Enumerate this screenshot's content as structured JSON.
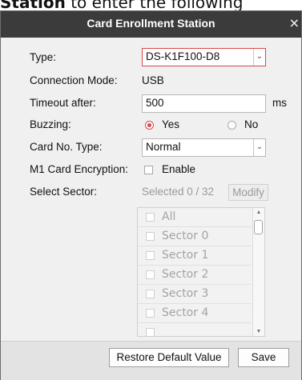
{
  "background": {
    "caption_bold": "Station",
    "caption_rest": " to enter the following"
  },
  "dialog": {
    "title": "Card Enrollment Station",
    "close_glyph": "×",
    "type": {
      "label": "Type:",
      "value": "DS-K1F100-D8"
    },
    "connection_mode": {
      "label": "Connection Mode:",
      "value": "USB"
    },
    "timeout": {
      "label": "Timeout after:",
      "value": "500",
      "unit": "ms"
    },
    "buzzing": {
      "label": "Buzzing:",
      "yes": "Yes",
      "no": "No",
      "selected": "Yes"
    },
    "card_no_type": {
      "label": "Card No. Type:",
      "value": "Normal"
    },
    "m1_encryption": {
      "label": "M1 Card Encryption:",
      "option": "Enable",
      "checked": false
    },
    "select_sector": {
      "label": "Select Sector:",
      "summary": "Selected 0 / 32",
      "modify": "Modify",
      "items": [
        "All",
        "Sector 0",
        "Sector 1",
        "Sector 2",
        "Sector 3",
        "Sector 4"
      ]
    },
    "footer": {
      "restore": "Restore Default Value",
      "save": "Save"
    }
  },
  "colors": {
    "titlebar": "#3b3b3b",
    "accent": "#d84848",
    "dialog_bg": "#f0f0f0"
  },
  "icons": {
    "dropdown": "chevron-down-icon",
    "close": "close-icon"
  }
}
